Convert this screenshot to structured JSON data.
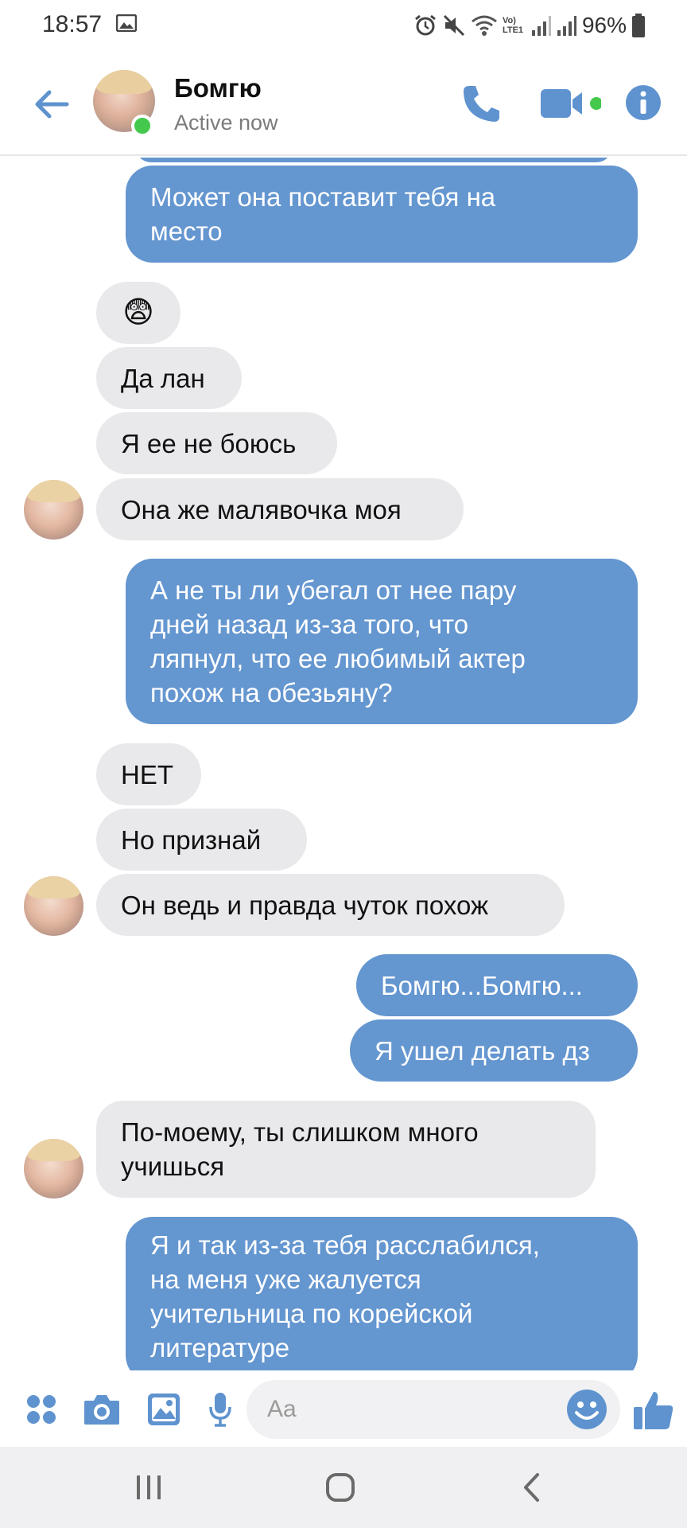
{
  "status_bar": {
    "time": "18:57",
    "battery": "96%",
    "network_label": "Vo) LTE1"
  },
  "header": {
    "contact_name": "Бомгю",
    "status": "Active now"
  },
  "messages": [
    {
      "dir": "out",
      "lines": [
        "Может она поставит тебя на",
        "место"
      ]
    },
    {
      "dir": "in",
      "text": "😨"
    },
    {
      "dir": "in",
      "text": "Да лан"
    },
    {
      "dir": "in",
      "text": "Я ее не боюсь"
    },
    {
      "dir": "in",
      "text": "Она же малявочка моя"
    },
    {
      "dir": "out",
      "lines": [
        "А не ты ли убегал от нее пару",
        "дней назад из-за того, что",
        "ляпнул, что ее любимый актер",
        "похож на обезьяну?"
      ]
    },
    {
      "dir": "in",
      "text": "НЕТ"
    },
    {
      "dir": "in",
      "text": "Но признай"
    },
    {
      "dir": "in",
      "text": "Он ведь и правда чуток похож"
    },
    {
      "dir": "out",
      "text": "Бомгю...Бомгю..."
    },
    {
      "dir": "out",
      "text": "Я ушел делать дз"
    },
    {
      "dir": "in",
      "lines": [
        "По-моему, ты слишком много",
        "учишься"
      ]
    },
    {
      "dir": "out",
      "lines": [
        "Я и так из-за тебя расслабился,",
        "на меня уже жалуется",
        "учительница по корейской",
        "литературе"
      ]
    }
  ],
  "composer": {
    "placeholder": "Aa"
  },
  "colors": {
    "accent": "#5f93cf",
    "outgoing_bubble": "#6496d0",
    "incoming_bubble": "#e9e9ec",
    "online": "#44c94d"
  }
}
